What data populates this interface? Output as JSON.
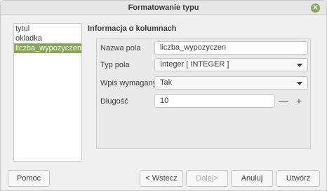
{
  "window": {
    "title": "Formatowanie typu"
  },
  "list": {
    "items": [
      "tytul",
      "okladka",
      "liczba_wypozyczen"
    ],
    "selected_index": 2
  },
  "section": {
    "title": "Informacja o kolumnach"
  },
  "fields": {
    "name": {
      "label": "Nazwa pola",
      "value": "liczba_wypozyczen"
    },
    "type": {
      "label": "Typ pola",
      "value": "Integer [ INTEGER ]"
    },
    "required": {
      "label": "Wpis wymagany",
      "value": "Tak"
    },
    "length": {
      "label": "Długość",
      "value": "10",
      "minus": "—",
      "plus": "+"
    }
  },
  "buttons": {
    "help": "Pomoc",
    "back": "< Wstecz",
    "next": "Dalej>",
    "cancel": "Anuluj",
    "create": "Utwórz"
  },
  "colors": {
    "accent": "#87a556"
  }
}
